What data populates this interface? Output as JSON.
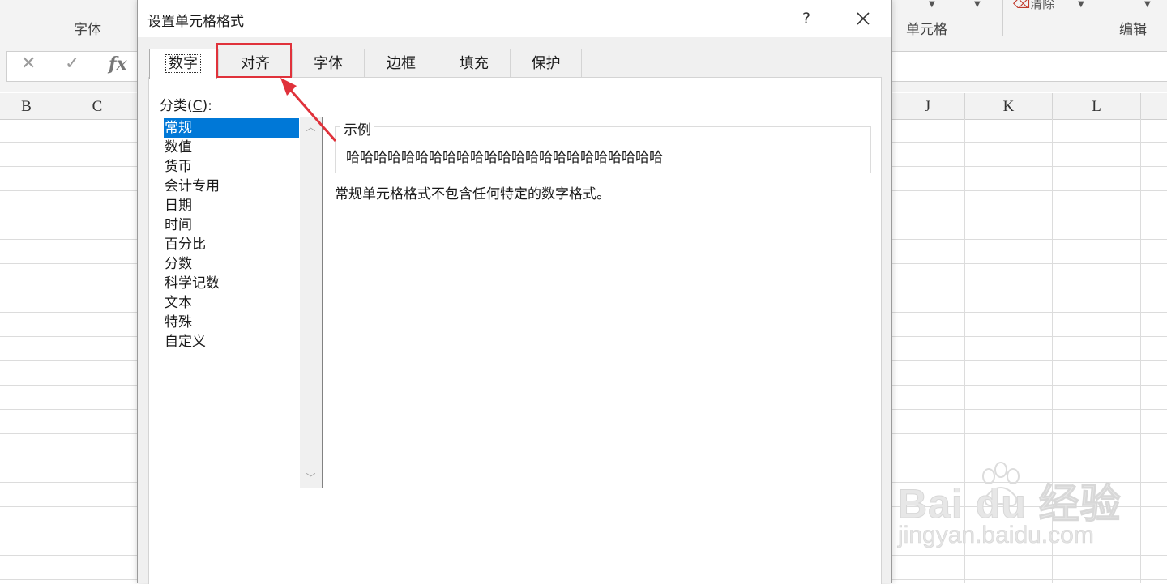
{
  "ribbon": {
    "group_font": "字体",
    "group_cells": "单元格",
    "group_edit": "编辑",
    "clear_label": "清除"
  },
  "formula_bar": {
    "cancel_icon": "close-icon",
    "enter_icon": "check-icon",
    "fx_label": "fx"
  },
  "columns": {
    "left": [
      "B",
      "C"
    ],
    "right": [
      "J",
      "K",
      "L"
    ]
  },
  "dialog": {
    "title": "设置单元格格式",
    "help_label": "?",
    "tabs": [
      "数字",
      "对齐",
      "字体",
      "边框",
      "填充",
      "保护"
    ],
    "active_tab": "数字",
    "highlighted_tab": "对齐",
    "category_label_pre": "分类(",
    "category_label_key": "C",
    "category_label_post": "):",
    "categories": [
      "常规",
      "数值",
      "货币",
      "会计专用",
      "日期",
      "时间",
      "百分比",
      "分数",
      "科学记数",
      "文本",
      "特殊",
      "自定义"
    ],
    "selected_category": "常规",
    "sample_legend": "示例",
    "sample_value": "哈哈哈哈哈哈哈哈哈哈哈哈哈哈哈哈哈哈哈哈哈哈哈",
    "description": "常规单元格格式不包含任何特定的数字格式。"
  },
  "watermark": {
    "main": "Bai du 经验",
    "sub": "jingyan.baidu.com"
  },
  "colors": {
    "selection": "#0078d7",
    "highlight_box": "#e0323b",
    "dialog_bg": "#f0f0f0"
  }
}
